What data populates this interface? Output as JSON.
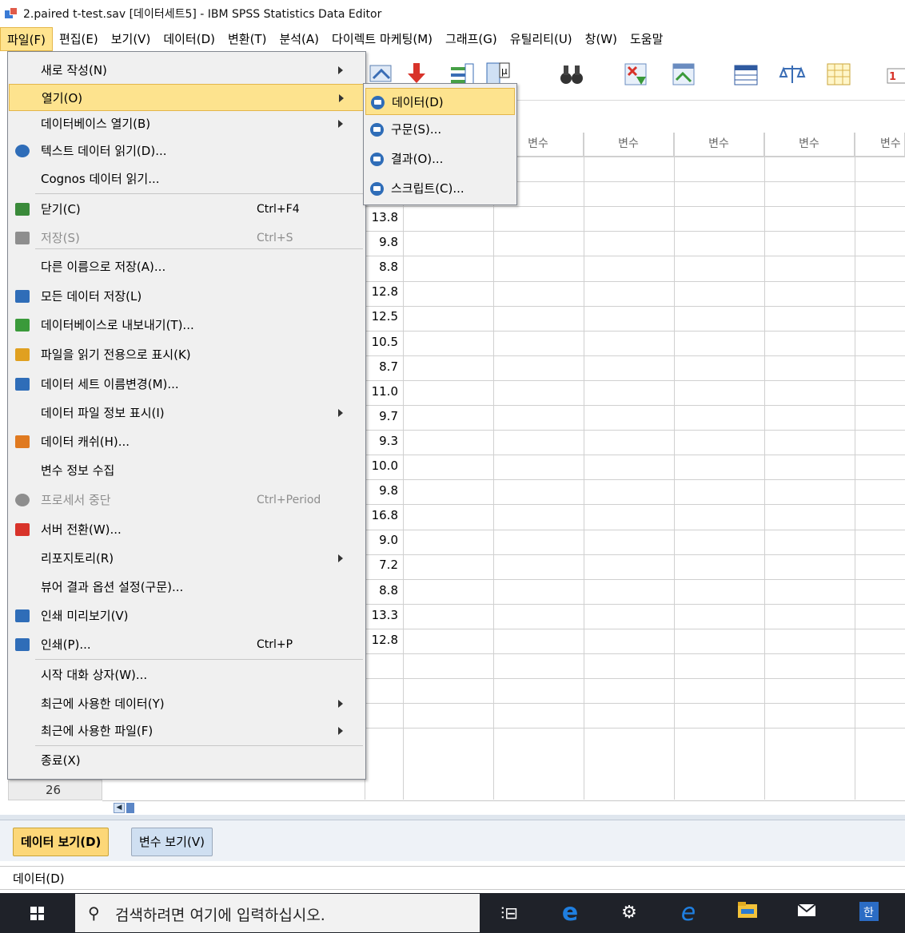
{
  "window": {
    "title": "2.paired t-test.sav [데이터세트5] - IBM SPSS Statistics Data Editor"
  },
  "menubar": [
    {
      "label": "파일(F)"
    },
    {
      "label": "편집(E)"
    },
    {
      "label": "보기(V)"
    },
    {
      "label": "데이터(D)"
    },
    {
      "label": "변환(T)"
    },
    {
      "label": "분석(A)"
    },
    {
      "label": "다이렉트 마케팅(M)"
    },
    {
      "label": "그래프(G)"
    },
    {
      "label": "유틸리티(U)"
    },
    {
      "label": "창(W)"
    },
    {
      "label": "도움말"
    }
  ],
  "file_menu": {
    "items": [
      {
        "label": "새로 작성(N)",
        "submenu": true
      },
      {
        "label": "열기(O)",
        "submenu": true,
        "highlighted": true
      },
      {
        "label": "데이터베이스 열기(B)",
        "submenu": true
      },
      {
        "label": "텍스트 데이터 읽기(D)...",
        "icon": "text-data-icon"
      },
      {
        "label": "Cognos 데이터 읽기..."
      },
      {
        "label": "닫기(C)",
        "shortcut": "Ctrl+F4",
        "icon": "close-doc-icon"
      },
      {
        "label": "저장(S)",
        "shortcut": "Ctrl+S",
        "icon": "save-icon",
        "disabled": true
      },
      {
        "label": "다른 이름으로 저장(A)..."
      },
      {
        "label": "모든 데이터 저장(L)",
        "icon": "save-all-icon"
      },
      {
        "label": "데이터베이스로 내보내기(T)...",
        "icon": "export-db-icon"
      },
      {
        "label": "파일을 읽기 전용으로 표시(K)",
        "icon": "readonly-icon"
      },
      {
        "label": "데이터 세트 이름변경(M)...",
        "icon": "rename-dataset-icon"
      },
      {
        "label": "데이터 파일 정보 표시(I)",
        "submenu": true
      },
      {
        "label": "데이터 캐쉬(H)...",
        "icon": "cache-icon"
      },
      {
        "label": "변수 정보 수집"
      },
      {
        "label": "프로세서 중단",
        "shortcut": "Ctrl+Period",
        "icon": "stop-icon",
        "disabled": true
      },
      {
        "label": "서버 전환(W)...",
        "icon": "server-icon"
      },
      {
        "label": "리포지토리(R)",
        "submenu": true
      },
      {
        "label": "뷰어 결과 옵션 설정(구문)..."
      },
      {
        "label": "인쇄 미리보기(V)",
        "icon": "print-preview-icon"
      },
      {
        "label": "인쇄(P)...",
        "shortcut": "Ctrl+P",
        "icon": "print-icon"
      },
      {
        "label": "시작 대화 상자(W)..."
      },
      {
        "label": "최근에 사용한 데이터(Y)",
        "submenu": true
      },
      {
        "label": "최근에 사용한 파일(F)",
        "submenu": true
      },
      {
        "label": "종료(X)"
      }
    ]
  },
  "open_submenu": {
    "items": [
      {
        "label": "데이터(D)",
        "highlighted": true
      },
      {
        "label": "구문(S)..."
      },
      {
        "label": "결과(O)..."
      },
      {
        "label": "스크립트(C)..."
      }
    ]
  },
  "grid": {
    "column_headers": [
      "변수",
      "변수",
      "변수",
      "변수",
      "변수"
    ],
    "values": [
      "13.8",
      "9.8",
      "8.8",
      "12.8",
      "12.5",
      "10.5",
      "8.7",
      "11.0",
      "9.7",
      "9.3",
      "10.0",
      "9.8",
      "16.8",
      "9.0",
      "7.2",
      "8.8",
      "13.3",
      "12.8"
    ],
    "last_row_number": "26"
  },
  "tabs": {
    "data_view": "데이터 보기(D)",
    "variable_view": "변수 보기(V)"
  },
  "status": {
    "text": "데이터(D)"
  },
  "taskbar": {
    "search_placeholder": "검색하려면 여기에 입력하십시오."
  },
  "colors": {
    "highlight": "#fde38e",
    "active_tab": "#fcd778",
    "taskbar": "#1f2229"
  }
}
